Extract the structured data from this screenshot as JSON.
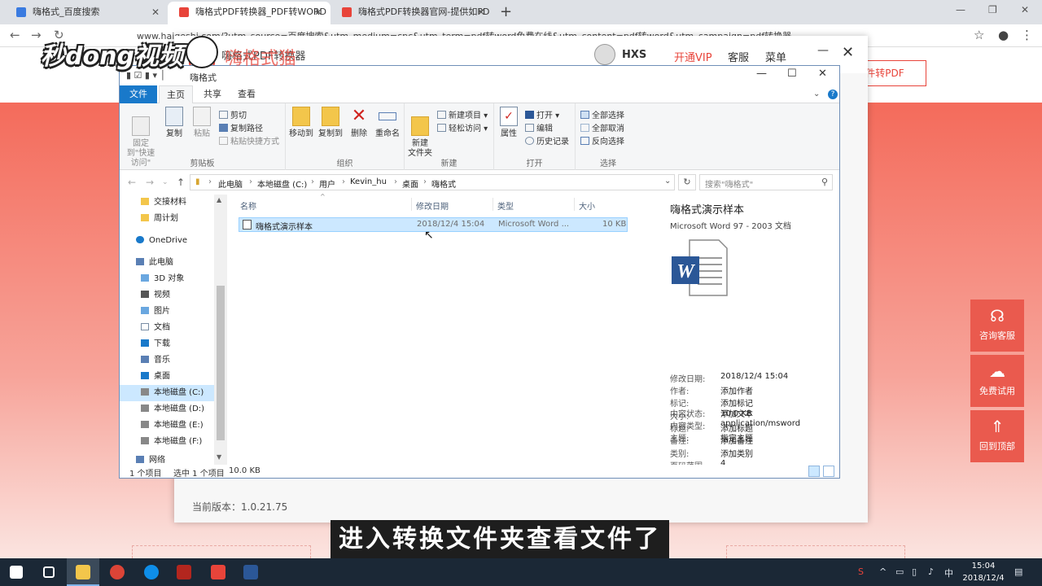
{
  "browser": {
    "tabs": [
      {
        "title": "嗨格式_百度搜索",
        "active": false
      },
      {
        "title": "嗨格式PDF转换器_PDF转WORD",
        "active": true
      },
      {
        "title": "嗨格式PDF转换器官网-提供如PD",
        "active": false
      }
    ],
    "url": "www.haigeshi.com/?utm_source=百度搜索&utm_medium=cpc&utm_term=pdf转word免费在线&utm_content=pdf转word&utm_campaign=pdf转换器"
  },
  "site": {
    "header_button": "件转PDF",
    "side_tools": [
      "咨询客服",
      "免费试用",
      "回到顶部"
    ],
    "accent": "#e8443a"
  },
  "app": {
    "title": "嗨格式PDF转换器",
    "user": "HXS",
    "vip": "开通VIP",
    "service": "客服",
    "menu": "菜单",
    "version": "当前版本：1.0.21.75"
  },
  "explorer": {
    "title": "嗨格式",
    "tabs": {
      "file": "文件",
      "home": "主页",
      "share": "共享",
      "view": "查看"
    },
    "ribbon": {
      "clipboard": {
        "pin": "固定到\"快速访问\"",
        "copy": "复制",
        "paste": "粘贴",
        "cut": "剪切",
        "copy_path": "复制路径",
        "paste_shortcut": "粘贴快捷方式",
        "label": "剪贴板"
      },
      "organize": {
        "move": "移动到",
        "copy_to": "复制到",
        "delete": "删除",
        "rename": "重命名",
        "label": "组织"
      },
      "new": {
        "folder": "新建\n文件夹",
        "new_item": "新建项目",
        "easy_access": "轻松访问",
        "label": "新建"
      },
      "open": {
        "properties": "属性",
        "open": "打开",
        "edit": "编辑",
        "history": "历史记录",
        "label": "打开"
      },
      "select": {
        "all": "全部选择",
        "none": "全部取消",
        "invert": "反向选择",
        "label": "选择"
      }
    },
    "breadcrumb": [
      "此电脑",
      "本地磁盘 (C:)",
      "用户",
      "Kevin_hu",
      "桌面",
      "嗨格式"
    ],
    "search_placeholder": "搜索\"嗨格式\"",
    "nav": [
      "交接材料",
      "周计划",
      "OneDrive",
      "此电脑",
      "3D 对象",
      "视频",
      "图片",
      "文档",
      "下载",
      "音乐",
      "桌面",
      "本地磁盘 (C:)",
      "本地磁盘 (D:)",
      "本地磁盘 (E:)",
      "本地磁盘 (F:)",
      "网络"
    ],
    "columns": [
      "名称",
      "修改日期",
      "类型",
      "大小"
    ],
    "files": [
      {
        "name": "嗨格式演示样本",
        "date": "2018/12/4 15:04",
        "type": "Microsoft Word ...",
        "size": "10 KB"
      }
    ],
    "preview": {
      "name": "嗨格式演示样本",
      "type": "Microsoft Word 97 - 2003 文档",
      "props": [
        {
          "label": "修改日期:",
          "value": "2018/12/4 15:04"
        },
        {
          "label": "作者:",
          "value": "添加作者"
        },
        {
          "label": "标记:",
          "value": "添加标记"
        },
        {
          "label": "大小:",
          "value": "10.0 KB"
        },
        {
          "label": "标题:",
          "value": "添加标题"
        },
        {
          "label": "备注:",
          "value": "添加备注"
        },
        {
          "label": "类别:",
          "value": "添加类别"
        },
        {
          "label": "页码范围:",
          "value": "4"
        },
        {
          "label": "内容状态:",
          "value": "添加文本"
        },
        {
          "label": "内容类型:",
          "value": "application/msword"
        },
        {
          "label": "主题:",
          "value": "指定主题"
        }
      ]
    },
    "status": {
      "count": "1 个项目",
      "selected": "选中 1 个项目",
      "size": "10.0 KB"
    }
  },
  "overlay": {
    "watermark": "秒dong视频",
    "watermark_sub": "嗨格式猫",
    "subtitle": "进入转换文件夹查看文件了"
  },
  "taskbar": {
    "time": "15:04",
    "date": "2018/12/4",
    "ime": "中"
  }
}
